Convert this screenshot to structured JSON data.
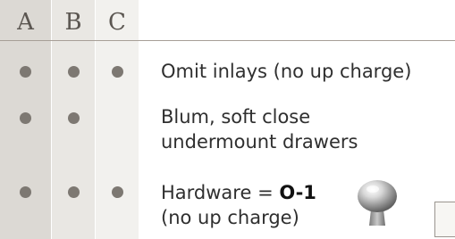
{
  "columns": [
    "A",
    "B",
    "C"
  ],
  "rows": [
    {
      "text": "Omit inlays (no up charge)",
      "a": true,
      "b": true,
      "c": true
    },
    {
      "lines": [
        "Blum, soft close",
        "undermount drawers"
      ],
      "a": true,
      "b": true,
      "c": false
    },
    {
      "prefix": "Hardware = ",
      "code": "O-1",
      "suffix": "(no up charge)",
      "a": true,
      "b": true,
      "c": true
    }
  ],
  "colors": {
    "dot": "#7d7872",
    "column_a": "#dcd9d4",
    "column_b": "#e9e7e3",
    "column_c": "#f2f1ee",
    "rule": "#a79f97"
  },
  "icons": {
    "hardware_image": "cabinet-knob-icon",
    "partial_box": "partial-box-icon"
  }
}
